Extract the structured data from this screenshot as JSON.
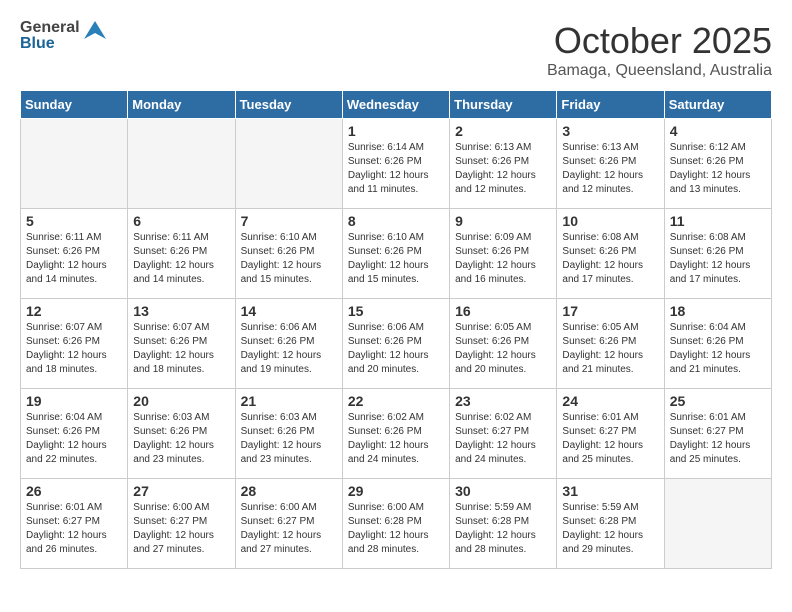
{
  "header": {
    "logo_general": "General",
    "logo_blue": "Blue",
    "month": "October 2025",
    "location": "Bamaga, Queensland, Australia"
  },
  "weekdays": [
    "Sunday",
    "Monday",
    "Tuesday",
    "Wednesday",
    "Thursday",
    "Friday",
    "Saturday"
  ],
  "weeks": [
    [
      {
        "day": "",
        "info": ""
      },
      {
        "day": "",
        "info": ""
      },
      {
        "day": "",
        "info": ""
      },
      {
        "day": "1",
        "info": "Sunrise: 6:14 AM\nSunset: 6:26 PM\nDaylight: 12 hours\nand 11 minutes."
      },
      {
        "day": "2",
        "info": "Sunrise: 6:13 AM\nSunset: 6:26 PM\nDaylight: 12 hours\nand 12 minutes."
      },
      {
        "day": "3",
        "info": "Sunrise: 6:13 AM\nSunset: 6:26 PM\nDaylight: 12 hours\nand 12 minutes."
      },
      {
        "day": "4",
        "info": "Sunrise: 6:12 AM\nSunset: 6:26 PM\nDaylight: 12 hours\nand 13 minutes."
      }
    ],
    [
      {
        "day": "5",
        "info": "Sunrise: 6:11 AM\nSunset: 6:26 PM\nDaylight: 12 hours\nand 14 minutes."
      },
      {
        "day": "6",
        "info": "Sunrise: 6:11 AM\nSunset: 6:26 PM\nDaylight: 12 hours\nand 14 minutes."
      },
      {
        "day": "7",
        "info": "Sunrise: 6:10 AM\nSunset: 6:26 PM\nDaylight: 12 hours\nand 15 minutes."
      },
      {
        "day": "8",
        "info": "Sunrise: 6:10 AM\nSunset: 6:26 PM\nDaylight: 12 hours\nand 15 minutes."
      },
      {
        "day": "9",
        "info": "Sunrise: 6:09 AM\nSunset: 6:26 PM\nDaylight: 12 hours\nand 16 minutes."
      },
      {
        "day": "10",
        "info": "Sunrise: 6:08 AM\nSunset: 6:26 PM\nDaylight: 12 hours\nand 17 minutes."
      },
      {
        "day": "11",
        "info": "Sunrise: 6:08 AM\nSunset: 6:26 PM\nDaylight: 12 hours\nand 17 minutes."
      }
    ],
    [
      {
        "day": "12",
        "info": "Sunrise: 6:07 AM\nSunset: 6:26 PM\nDaylight: 12 hours\nand 18 minutes."
      },
      {
        "day": "13",
        "info": "Sunrise: 6:07 AM\nSunset: 6:26 PM\nDaylight: 12 hours\nand 18 minutes."
      },
      {
        "day": "14",
        "info": "Sunrise: 6:06 AM\nSunset: 6:26 PM\nDaylight: 12 hours\nand 19 minutes."
      },
      {
        "day": "15",
        "info": "Sunrise: 6:06 AM\nSunset: 6:26 PM\nDaylight: 12 hours\nand 20 minutes."
      },
      {
        "day": "16",
        "info": "Sunrise: 6:05 AM\nSunset: 6:26 PM\nDaylight: 12 hours\nand 20 minutes."
      },
      {
        "day": "17",
        "info": "Sunrise: 6:05 AM\nSunset: 6:26 PM\nDaylight: 12 hours\nand 21 minutes."
      },
      {
        "day": "18",
        "info": "Sunrise: 6:04 AM\nSunset: 6:26 PM\nDaylight: 12 hours\nand 21 minutes."
      }
    ],
    [
      {
        "day": "19",
        "info": "Sunrise: 6:04 AM\nSunset: 6:26 PM\nDaylight: 12 hours\nand 22 minutes."
      },
      {
        "day": "20",
        "info": "Sunrise: 6:03 AM\nSunset: 6:26 PM\nDaylight: 12 hours\nand 23 minutes."
      },
      {
        "day": "21",
        "info": "Sunrise: 6:03 AM\nSunset: 6:26 PM\nDaylight: 12 hours\nand 23 minutes."
      },
      {
        "day": "22",
        "info": "Sunrise: 6:02 AM\nSunset: 6:26 PM\nDaylight: 12 hours\nand 24 minutes."
      },
      {
        "day": "23",
        "info": "Sunrise: 6:02 AM\nSunset: 6:27 PM\nDaylight: 12 hours\nand 24 minutes."
      },
      {
        "day": "24",
        "info": "Sunrise: 6:01 AM\nSunset: 6:27 PM\nDaylight: 12 hours\nand 25 minutes."
      },
      {
        "day": "25",
        "info": "Sunrise: 6:01 AM\nSunset: 6:27 PM\nDaylight: 12 hours\nand 25 minutes."
      }
    ],
    [
      {
        "day": "26",
        "info": "Sunrise: 6:01 AM\nSunset: 6:27 PM\nDaylight: 12 hours\nand 26 minutes."
      },
      {
        "day": "27",
        "info": "Sunrise: 6:00 AM\nSunset: 6:27 PM\nDaylight: 12 hours\nand 27 minutes."
      },
      {
        "day": "28",
        "info": "Sunrise: 6:00 AM\nSunset: 6:27 PM\nDaylight: 12 hours\nand 27 minutes."
      },
      {
        "day": "29",
        "info": "Sunrise: 6:00 AM\nSunset: 6:28 PM\nDaylight: 12 hours\nand 28 minutes."
      },
      {
        "day": "30",
        "info": "Sunrise: 5:59 AM\nSunset: 6:28 PM\nDaylight: 12 hours\nand 28 minutes."
      },
      {
        "day": "31",
        "info": "Sunrise: 5:59 AM\nSunset: 6:28 PM\nDaylight: 12 hours\nand 29 minutes."
      },
      {
        "day": "",
        "info": ""
      }
    ]
  ]
}
